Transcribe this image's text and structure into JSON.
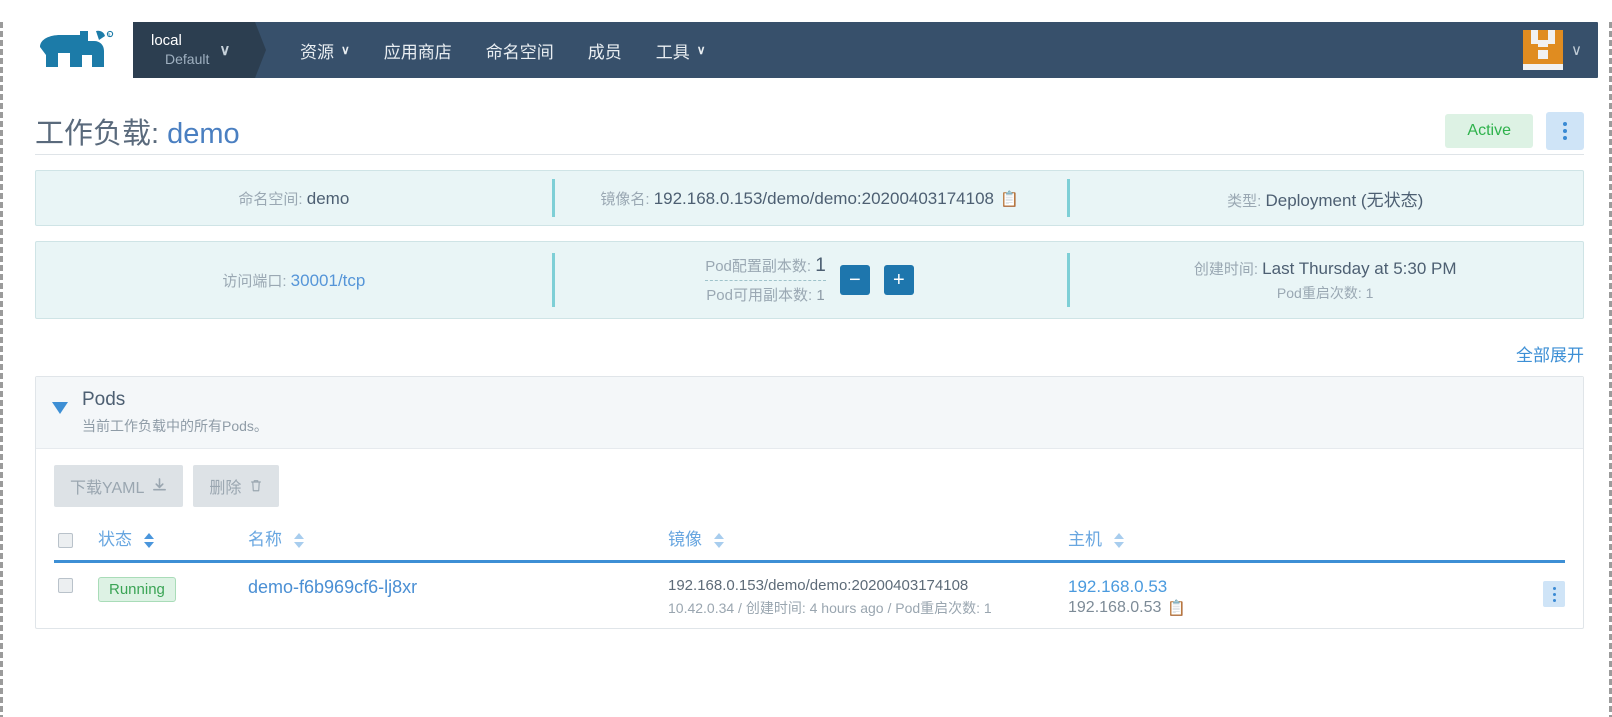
{
  "navbar": {
    "logo_name": "rancher-logo",
    "cluster": {
      "name": "local",
      "project": "Default",
      "caret": "⌄"
    },
    "items": [
      {
        "label": "资源",
        "has_caret": true
      },
      {
        "label": "应用商店",
        "has_caret": false
      },
      {
        "label": "命名空间",
        "has_caret": false
      },
      {
        "label": "成员",
        "has_caret": false
      },
      {
        "label": "工具",
        "has_caret": true
      }
    ],
    "caret_glyph": "∨",
    "avatar_caret": "∨"
  },
  "header": {
    "title_prefix": "工作负载",
    "title_sep": ": ",
    "title_name": "demo",
    "status_badge": "Active",
    "kebab_name": "workload-actions-menu"
  },
  "info_card_1": [
    {
      "label": "命名空间",
      "value": "demo",
      "copy": false,
      "link": false
    },
    {
      "label": "镜像名",
      "value": "192.168.0.153/demo/demo:20200403174108",
      "copy": true,
      "link": false
    },
    {
      "label": "类型",
      "value": "Deployment (无状态)",
      "copy": false,
      "link": false
    }
  ],
  "info_card_2": {
    "port": {
      "label": "访问端口",
      "value": "30001/tcp"
    },
    "scale": {
      "configured_label": "Pod配置副本数",
      "configured_value": "1",
      "available_label": "Pod可用副本数",
      "available_value": "1",
      "minus": "−",
      "plus": "+"
    },
    "created": {
      "label": "创建时间",
      "value": "Last Thursday at 5:30 PM",
      "sub_label": "Pod重启次数",
      "sub_value": "1"
    }
  },
  "expand_all": "全部展开",
  "pods_section": {
    "title": "Pods",
    "description": "当前工作负载中的所有Pods。",
    "buttons": [
      {
        "label": "下载YAML",
        "icon": "download-icon"
      },
      {
        "label": "删除",
        "icon": "trash-icon"
      }
    ],
    "columns": [
      {
        "label": "状态",
        "sortable": true,
        "active": true
      },
      {
        "label": "名称",
        "sortable": true,
        "active": false
      },
      {
        "label": "镜像",
        "sortable": true,
        "active": false
      },
      {
        "label": "主机",
        "sortable": true,
        "active": false
      }
    ],
    "rows": [
      {
        "status": "Running",
        "name": "demo-f6b969cf6-lj8xr",
        "image": "192.168.0.153/demo/demo:20200403174108",
        "image_sub": "10.42.0.34 / 创建时间: 4 hours ago / Pod重启次数: 1",
        "host_link": "192.168.0.53",
        "host_ip": "192.168.0.53"
      }
    ]
  },
  "colors": {
    "navbar_bg": "#37506b",
    "cluster_bg": "#2c3e50",
    "accent_blue": "#3d8fd5",
    "card_bg": "#e9f5f6",
    "card_border": "#cfe4e6",
    "divider_teal": "#7ecfd6",
    "active_green": "#2eb24c",
    "active_green_bg": "#ddf2e4",
    "step_button": "#1e76ad",
    "avatar_orange": "#e08c20"
  }
}
